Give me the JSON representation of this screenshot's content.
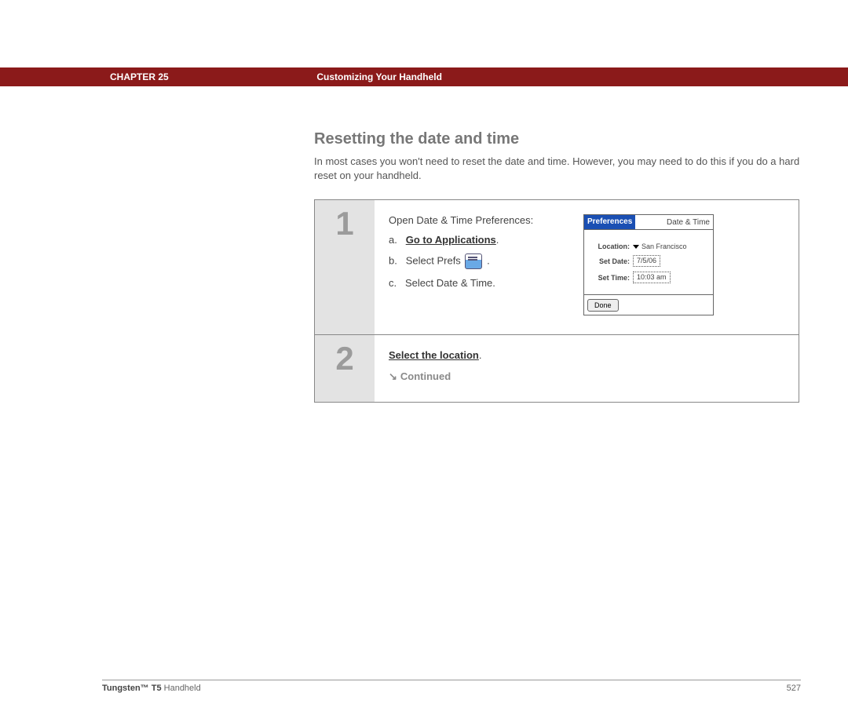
{
  "chapter": {
    "label": "CHAPTER 25",
    "title": "Customizing Your Handheld"
  },
  "section": {
    "heading": "Resetting the date and time",
    "intro": "In most cases you won't need to reset the date and time. However, you may need to do this if you do a hard reset on your handheld."
  },
  "steps": {
    "s1": {
      "num": "1",
      "lead": "Open Date & Time Preferences:",
      "a_prefix": "a.",
      "a_link": "Go to Applications",
      "a_suffix": ".",
      "b_prefix": "b.",
      "b_text": "Select Prefs",
      "b_suffix": ".",
      "c_prefix": "c.",
      "c_text": "Select Date & Time."
    },
    "s2": {
      "num": "2",
      "link": "Select the location",
      "suffix": ".",
      "continued": "Continued"
    }
  },
  "palm": {
    "title": "Preferences",
    "category": "Date & Time",
    "location_label": "Location:",
    "location_value": "San Francisco",
    "date_label": "Set Date:",
    "date_value": "7/5/06",
    "time_label": "Set Time:",
    "time_value": "10:03 am",
    "done": "Done"
  },
  "footer": {
    "product_bold": "Tungsten™ T5",
    "product_rest": " Handheld",
    "page": "527"
  }
}
